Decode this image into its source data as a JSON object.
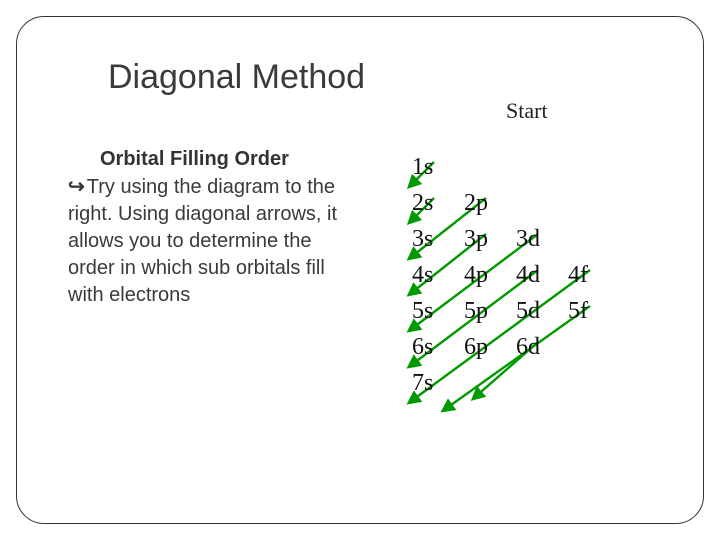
{
  "title": "Diagonal Method",
  "start_label": "Start",
  "subtitle": "Orbital Filling Order",
  "bullet_icon": "↪",
  "bullet_text": "Try using the diagram to the right. Using diagonal arrows, it allows you to determine the order in which sub orbitals fill with electrons",
  "grid": {
    "r1c1": "1s",
    "r2c1": "2s",
    "r2c2": "2p",
    "r3c1": "3s",
    "r3c2": "3p",
    "r3c3": "3d",
    "r4c1": "4s",
    "r4c2": "4p",
    "r4c3": "4d",
    "r4c4": "4f",
    "r5c1": "5s",
    "r5c2": "5p",
    "r5c3": "5d",
    "r5c4": "5f",
    "r6c1": "6s",
    "r6c2": "6p",
    "r6c3": "6d",
    "r7c1": "7s"
  },
  "colors": {
    "arrow": "#009900"
  }
}
